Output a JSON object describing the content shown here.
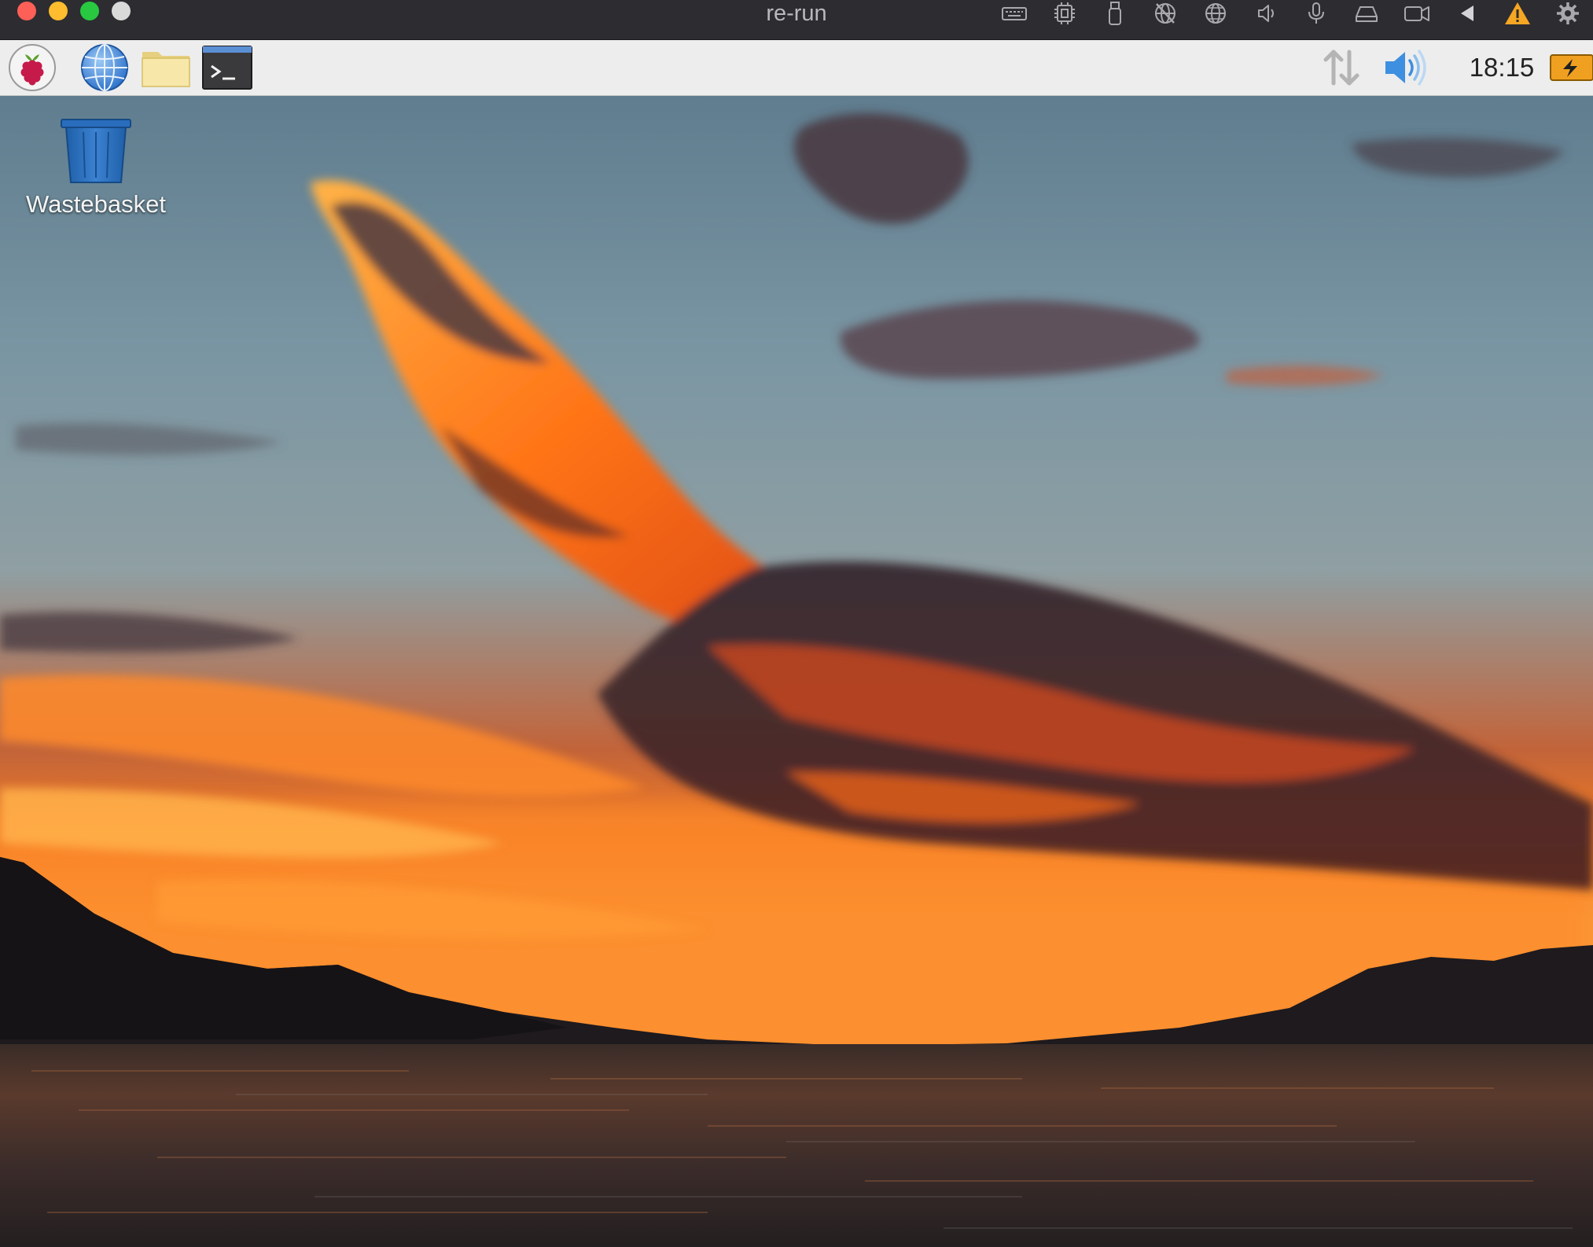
{
  "window": {
    "title": "re-run",
    "controls": [
      "close",
      "minimize",
      "zoom",
      "extra"
    ],
    "toolbar_icons": [
      "keyboard-icon",
      "cpu-chip-icon",
      "usb-drive-icon",
      "globe-off-icon",
      "globe-icon",
      "speaker-icon",
      "microphone-icon",
      "hard-disk-icon",
      "camera-icon",
      "send-arrow-icon",
      "warning-icon",
      "gear-icon"
    ],
    "colors": {
      "bar": "#2d2c31",
      "close": "#fe5f57",
      "minimize": "#febc2e",
      "zoom": "#28c840",
      "warning": "#f5a623"
    }
  },
  "panel": {
    "launchers": [
      "raspberry-menu-icon",
      "web-browser-icon",
      "file-manager-icon",
      "terminal-icon"
    ],
    "tray": [
      "network-arrows-icon",
      "volume-icon",
      "battery-icon"
    ],
    "clock": "18:15",
    "colors": {
      "background": "#ededed",
      "volume": "#3d8fe0",
      "battery": "#f0a020"
    }
  },
  "desktop": {
    "icons": [
      {
        "label": "Wastebasket",
        "icon": "wastebasket-icon"
      }
    ],
    "wallpaper": "sunset-over-lake",
    "colors": {
      "sky": "#6f8c9b",
      "cloud_glow": "#ff7a1a",
      "water": "#2a2524"
    }
  }
}
